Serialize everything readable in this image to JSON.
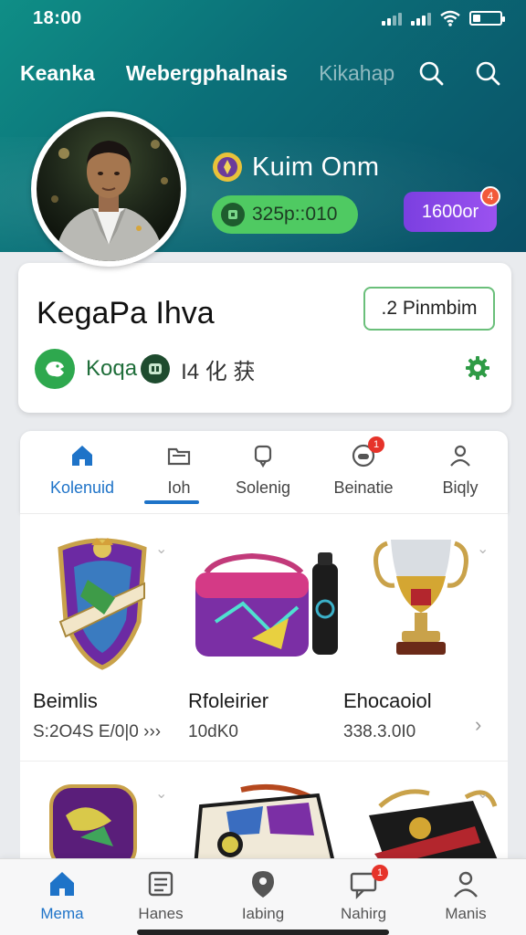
{
  "status": {
    "time": "18:00"
  },
  "top_nav": {
    "links": [
      "Keanka",
      "Webergphalnais",
      "Kikahap"
    ]
  },
  "profile": {
    "user_name": "Kuim Onm",
    "coins": "325p::010",
    "gems": "1600or",
    "gem_badge": "4"
  },
  "club": {
    "name": "KegaPa Ihva",
    "premium_label": ".2 Pinmbim",
    "team_label": "Koqa",
    "team_code": "I4 化 获"
  },
  "tabs": [
    {
      "label": "Kolenuid",
      "icon": "home-icon"
    },
    {
      "label": "Ioh",
      "icon": "folder-icon"
    },
    {
      "label": "Solenig",
      "icon": "chat-icon"
    },
    {
      "label": "Beinatie",
      "icon": "gamepad-icon",
      "badge": "1"
    },
    {
      "label": "Biqly",
      "icon": "user-icon"
    }
  ],
  "products": [
    {
      "name": "Beimlis",
      "price": "S:2O4S E/0|0 ›››",
      "image": "shield"
    },
    {
      "name": "Rfoleirier",
      "price": "10dK0",
      "image": "bag-bottle"
    },
    {
      "name": "Ehocaoiol",
      "price": "338.3.0I0",
      "image": "trophy"
    },
    {
      "name": "",
      "price": "",
      "image": "purple-bag"
    },
    {
      "name": "",
      "price": "",
      "image": "crest-bag"
    },
    {
      "name": "",
      "price": "",
      "image": "black-bag"
    }
  ],
  "bottom_nav": [
    {
      "label": "Mema",
      "icon": "home-icon"
    },
    {
      "label": "Hanes",
      "icon": "list-icon"
    },
    {
      "label": "Iabing",
      "icon": "pin-icon"
    },
    {
      "label": "Nahirg",
      "icon": "message-icon",
      "badge": "1"
    },
    {
      "label": "Manis",
      "icon": "profile-icon"
    }
  ],
  "colors": {
    "header_start": "#0f8e86",
    "header_end": "#0a4f66",
    "accent_blue": "#1e73c8",
    "coin_green": "#4fca62",
    "gem_purple": "#8a48e8",
    "alert_red": "#e6332a"
  }
}
